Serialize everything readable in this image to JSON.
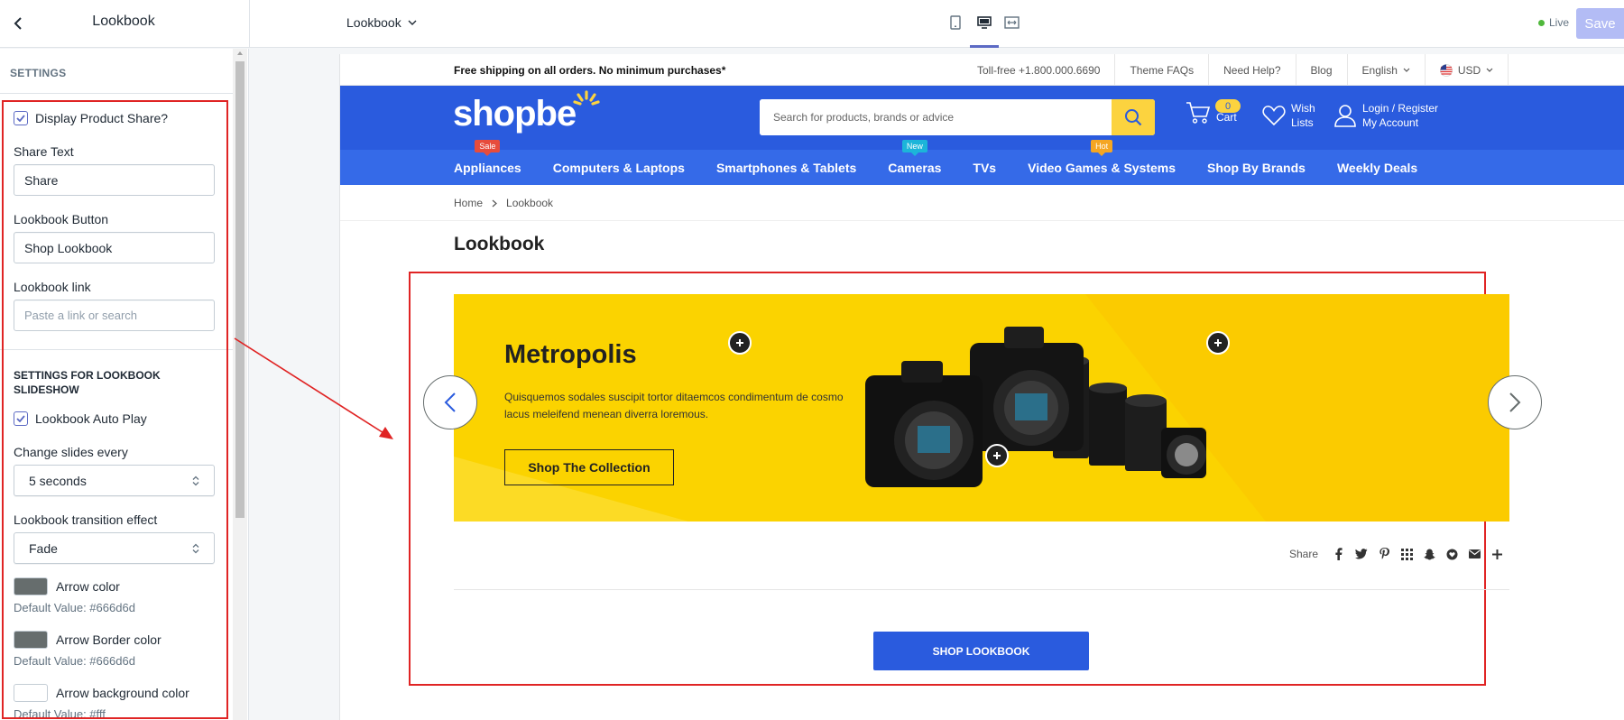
{
  "editor": {
    "panel_title": "Lookbook",
    "page_selector": "Lookbook",
    "live_label": "Live",
    "save_label": "Save",
    "accent_color": "#5c6ac4"
  },
  "sidebar": {
    "settings_heading": "SETTINGS",
    "display_product_share": {
      "label": "Display Product Share?",
      "checked": true
    },
    "share_text": {
      "label": "Share Text",
      "value": "Share"
    },
    "lookbook_button": {
      "label": "Lookbook Button",
      "value": "Shop Lookbook"
    },
    "lookbook_link": {
      "label": "Lookbook link",
      "placeholder": "Paste a link or search"
    },
    "slideshow_heading": "SETTINGS FOR LOOKBOOK SLIDESHOW",
    "auto_play": {
      "label": "Lookbook Auto Play",
      "checked": true
    },
    "change_slides": {
      "label": "Change slides every",
      "value": "5 seconds"
    },
    "transition": {
      "label": "Lookbook transition effect",
      "value": "Fade"
    },
    "arrow_color": {
      "label": "Arrow color",
      "default": "Default Value: #666d6d",
      "color": "#666d6d"
    },
    "arrow_border_color": {
      "label": "Arrow Border color",
      "default": "Default Value: #666d6d",
      "color": "#666d6d"
    },
    "arrow_bg_color": {
      "label": "Arrow background color",
      "default": "Default Value: #fff",
      "color": "#ffffff"
    }
  },
  "store": {
    "promo": "Free shipping on all orders. No minimum purchases*",
    "tollfree": "Toll-free +1.800.000.6690",
    "theme_faqs": "Theme FAQs",
    "need_help": "Need Help?",
    "blog": "Blog",
    "language": "English",
    "currency": "USD",
    "logo": "shopbe",
    "search_placeholder": "Search for products, brands or advice",
    "cart_count": "0",
    "cart_label": "Cart",
    "wish_line1": "Wish",
    "wish_line2": "Lists",
    "account_line1": "Login / Register",
    "account_line2": "My Account",
    "brand_blue": "#2a5bde",
    "brand_yellow": "#fcd33f",
    "nav": [
      {
        "label": "Appliances",
        "badge": "Sale",
        "badge_color": "#e74c3c"
      },
      {
        "label": "Computers & Laptops"
      },
      {
        "label": "Smartphones & Tablets"
      },
      {
        "label": "Cameras",
        "badge": "New",
        "badge_color": "#1cb5d9"
      },
      {
        "label": "TVs"
      },
      {
        "label": "Video Games & Systems",
        "badge": "Hot",
        "badge_color": "#f5a623"
      },
      {
        "label": "Shop By Brands"
      },
      {
        "label": "Weekly Deals"
      }
    ],
    "breadcrumb": {
      "home": "Home",
      "current": "Lookbook"
    },
    "page_title": "Lookbook",
    "slide": {
      "heading": "Metropolis",
      "text": "Quisquemos sodales suscipit tortor ditaemcos condimentum de cosmo lacus meleifend menean diverra loremous.",
      "cta": "Shop The Collection",
      "bg_color": "#fbd300"
    },
    "share_label": "Share",
    "shop_lookbook_button": "SHOP LOOKBOOK"
  }
}
